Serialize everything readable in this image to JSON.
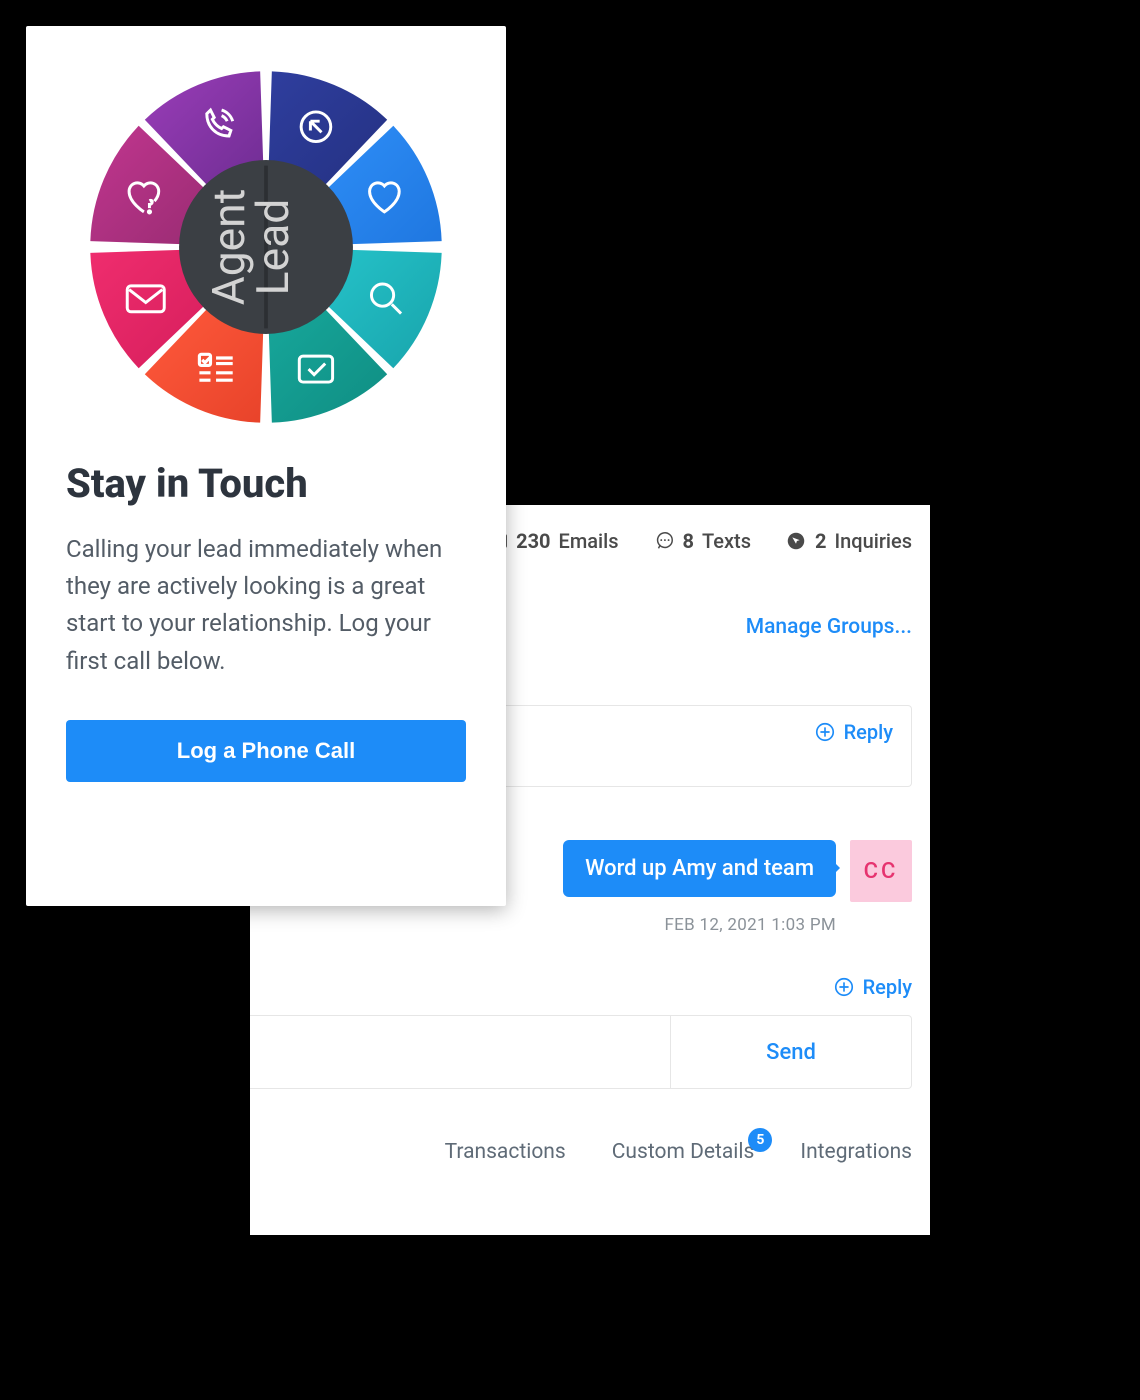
{
  "card": {
    "title": "Stay in Touch",
    "body": "Calling your lead immediately when they are actively looking is a great start to your relationship. Log your first call below.",
    "cta": "Log a Phone Call",
    "hub_left": "Agent",
    "hub_right": "Lead"
  },
  "stats": {
    "emails_count": "230",
    "emails_label": "Emails",
    "texts_count": "8",
    "texts_label": "Texts",
    "inquiries_count": "2",
    "inquiries_label": "Inquiries"
  },
  "links": {
    "manage_groups": "Manage Groups...",
    "reply": "Reply",
    "send": "Send"
  },
  "message": {
    "text": "Word up Amy and team",
    "avatar": "CC",
    "timestamp": "FEB 12, 2021 1:03 PM"
  },
  "tabs": {
    "transactions": "Transactions",
    "custom_details": "Custom Details",
    "custom_details_badge": "5",
    "integrations": "Integrations"
  },
  "colors": {
    "primary": "#1d8cf8",
    "avatar_bg": "#fbcadd",
    "avatar_fg": "#e6336f"
  }
}
